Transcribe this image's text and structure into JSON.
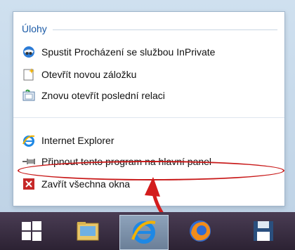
{
  "jump_list": {
    "section_title": "Úlohy",
    "tasks": [
      {
        "label": "Spustit Procházení se službou InPrivate",
        "icon": "inprivate-icon"
      },
      {
        "label": "Otevřít novou záložku",
        "icon": "new-tab-icon"
      },
      {
        "label": "Znovu otevřít poslední relaci",
        "icon": "reopen-session-icon"
      }
    ],
    "app_items": [
      {
        "label": "Internet Explorer",
        "icon": "internet-explorer-icon"
      },
      {
        "label": "Připnout tento program na hlavní panel",
        "icon": "pin-icon"
      },
      {
        "label": "Zavřít všechna okna",
        "icon": "close-all-icon"
      }
    ]
  },
  "taskbar": {
    "buttons": [
      {
        "icon": "windows-start-icon"
      },
      {
        "icon": "file-explorer-icon"
      },
      {
        "icon": "internet-explorer-icon",
        "active": true
      },
      {
        "icon": "firefox-icon"
      },
      {
        "icon": "save-disk-icon"
      }
    ]
  },
  "colors": {
    "accent": "#1a5aa6",
    "highlight": "#c81818",
    "taskbar": "#3a2f42"
  }
}
